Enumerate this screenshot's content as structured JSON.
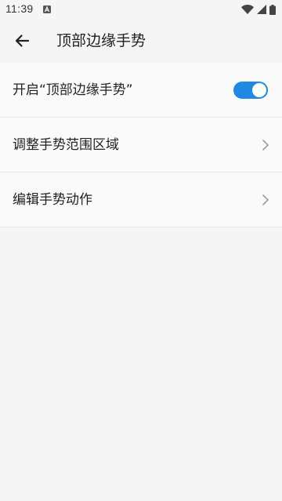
{
  "status_bar": {
    "time": "11:39",
    "icons": [
      "notification-a-icon",
      "wifi-icon",
      "signal-icon",
      "battery-icon"
    ]
  },
  "toolbar": {
    "back_icon": "arrow-left-icon",
    "title": "顶部边缘手势"
  },
  "settings": {
    "toggle_row": {
      "label": "开启“顶部边缘手势”",
      "enabled": true
    },
    "items": [
      {
        "label": "调整手势范围区域",
        "icon": "chevron-right-icon"
      },
      {
        "label": "编辑手势动作",
        "icon": "chevron-right-icon"
      }
    ]
  },
  "colors": {
    "accent": "#1e88e5",
    "background": "#f5f5f5",
    "card": "#fafafa",
    "text": "#222222"
  }
}
